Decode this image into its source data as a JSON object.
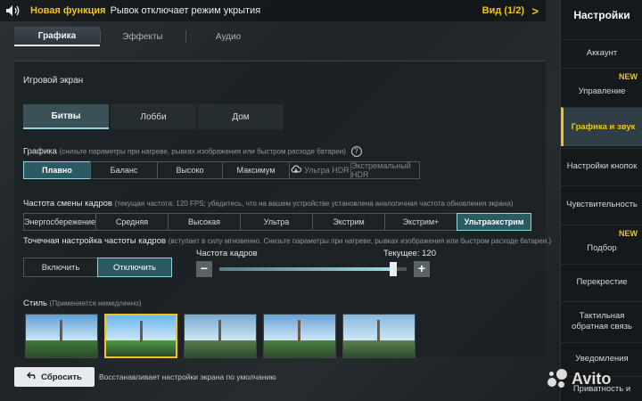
{
  "banner": {
    "new_label": "Новая функция",
    "text": "Рывок отключает режим укрытия",
    "view_label": "Вид (1/2)",
    "arrow": ">"
  },
  "tabs": [
    {
      "label": "Графика",
      "active": true
    },
    {
      "label": "Эффекты",
      "active": false
    },
    {
      "label": "Аудио",
      "active": false
    }
  ],
  "main": {
    "section_title": "Игровой экран",
    "subtabs": [
      {
        "label": "Битвы",
        "active": true
      },
      {
        "label": "Лобби",
        "active": false
      },
      {
        "label": "Дом",
        "active": false
      }
    ],
    "graphics": {
      "label": "Графика",
      "hint": "(снизьте параметры при нагреве, рывках изображения или быстром расходе батареи)",
      "help": "?",
      "options": [
        "Плавно",
        "Баланс",
        "Высоко",
        "Максимум",
        "Ультра HDR",
        "Экстремальный HDR"
      ],
      "selected": "Плавно"
    },
    "fps": {
      "label": "Частота смены кадров",
      "hint": "(текущая частота: 120 FPS; убедитесь, что на вашем устройстве установлена аналогичная частота обновления экрана)",
      "options": [
        "Энергосбережение",
        "Средняя",
        "Высокая",
        "Ультра",
        "Экстрим",
        "Экстрим+",
        "Ультраэкстрим"
      ],
      "selected": "Ультраэкстрим"
    },
    "fine_tune": {
      "label": "Точечная настройка частоты кадров",
      "hint": "(вступает в силу мгновенно. Снизьте параметры при нагреве, рывках изображения или быстром расходе батареи.)",
      "on_label": "Включить",
      "off_label": "Отключить",
      "selected": "Отключить"
    },
    "slider": {
      "label": "Частота кадров",
      "current_label": "Текущее: 120",
      "minus": "−",
      "plus": "+",
      "fraction": 0.93
    },
    "style": {
      "label": "Стиль",
      "hint": "(Применяется немедленно)",
      "count": 5,
      "selected_index": 1
    }
  },
  "bottom": {
    "reset_label": "Сбросить",
    "reset_desc": "Восстанавливает настройки экрана по умолчанию"
  },
  "sidebar": {
    "title": "Настройки",
    "items": [
      {
        "label": "Аккаунт",
        "new": ""
      },
      {
        "label": "Управление",
        "new": "NEW"
      },
      {
        "label": "Графика и звук",
        "new": "",
        "active": true
      },
      {
        "label": "Настройки кнопок",
        "new": ""
      },
      {
        "label": "Чувствительность",
        "new": ""
      },
      {
        "label": "Подбор",
        "new": "NEW"
      },
      {
        "label": "Перекрестие",
        "new": ""
      },
      {
        "label": "Тактильная обратная связь",
        "new": ""
      },
      {
        "label": "Уведомления",
        "new": ""
      },
      {
        "label": "Приватность и",
        "new": ""
      }
    ]
  },
  "watermark": "Avito",
  "colors": {
    "accent_yellow": "#f0c419",
    "selected_cyan": "#8fd3e0",
    "selected_bg": "#2c5a63"
  }
}
